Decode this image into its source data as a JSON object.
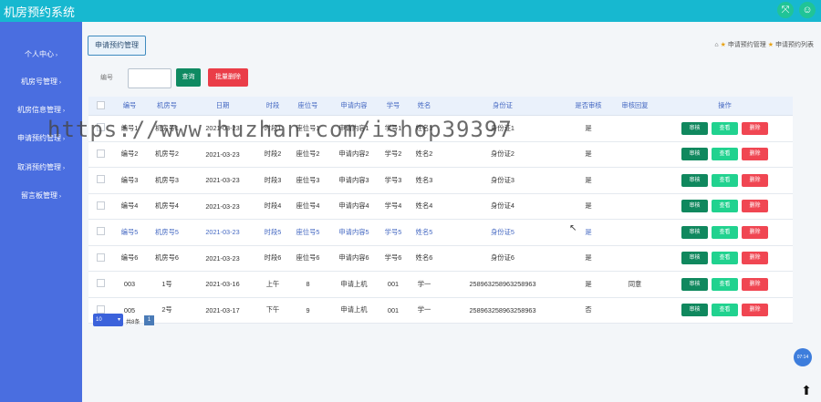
{
  "app": {
    "title": "机房预约系统",
    "icons": [
      "expand-icon",
      "user-icon"
    ]
  },
  "sidebar": {
    "items": [
      {
        "label": "个人中心",
        "caret": "›"
      },
      {
        "label": "机房号管理",
        "caret": "›"
      },
      {
        "label": "机房信息管理",
        "caret": "›"
      },
      {
        "label": "申请预约管理",
        "caret": "›"
      },
      {
        "label": "取消预约管理",
        "caret": "›"
      },
      {
        "label": "留言板管理",
        "caret": "›"
      }
    ]
  },
  "page": {
    "tab_label": "申请预约管理",
    "breadcrumb": {
      "first": "申请预约管理",
      "second": "申请预约列表"
    }
  },
  "search": {
    "label": "编号",
    "value": "",
    "search_button": "查询",
    "batch_delete_button": "批量删除"
  },
  "table": {
    "headers": [
      "",
      "编号",
      "机房号",
      "日期",
      "时段",
      "座位号",
      "申请内容",
      "学号",
      "姓名",
      "身份证",
      "是否审核",
      "审核回复",
      "操作"
    ],
    "actions": {
      "review": "审核",
      "view": "查看",
      "delete": "删除"
    },
    "rows": [
      [
        "编号1",
        "机房号1",
        "2021-03-23",
        "时段1",
        "座位号1",
        "申请内容1",
        "学号1",
        "姓名1",
        "身份证1",
        "是",
        ""
      ],
      [
        "编号2",
        "机房号2",
        "2021-03-23",
        "时段2",
        "座位号2",
        "申请内容2",
        "学号2",
        "姓名2",
        "身份证2",
        "是",
        ""
      ],
      [
        "编号3",
        "机房号3",
        "2021-03-23",
        "时段3",
        "座位号3",
        "申请内容3",
        "学号3",
        "姓名3",
        "身份证3",
        "是",
        ""
      ],
      [
        "编号4",
        "机房号4",
        "2021-03-23",
        "时段4",
        "座位号4",
        "申请内容4",
        "学号4",
        "姓名4",
        "身份证4",
        "是",
        ""
      ],
      [
        "编号5",
        "机房号5",
        "2021-03-23",
        "时段5",
        "座位号5",
        "申请内容5",
        "学号5",
        "姓名5",
        "身份证5",
        "是",
        ""
      ],
      [
        "编号6",
        "机房号6",
        "2021-03-23",
        "时段6",
        "座位号6",
        "申请内容6",
        "学号6",
        "姓名6",
        "身份证6",
        "是",
        ""
      ],
      [
        "003",
        "1号",
        "2021-03-16",
        "上午",
        "8",
        "申请上机",
        "001",
        "学一",
        "258963258963258963",
        "是",
        "同意"
      ],
      [
        "005",
        "2号",
        "2021-03-17",
        "下午",
        "9",
        "申请上机",
        "001",
        "学一",
        "258963258963258963",
        "否",
        ""
      ]
    ],
    "highlight_row": 4
  },
  "pager": {
    "page_size": "10",
    "total_text": "共8条",
    "current_page": "1"
  },
  "clock_badge": "07:14",
  "watermark": "https://www.huzhan.com/ishop39397",
  "colors": {
    "topbar": "#17b8d0",
    "sidebar": "#4a6ee0",
    "review": "#10885e",
    "view": "#21d28f",
    "delete": "#f04652"
  }
}
